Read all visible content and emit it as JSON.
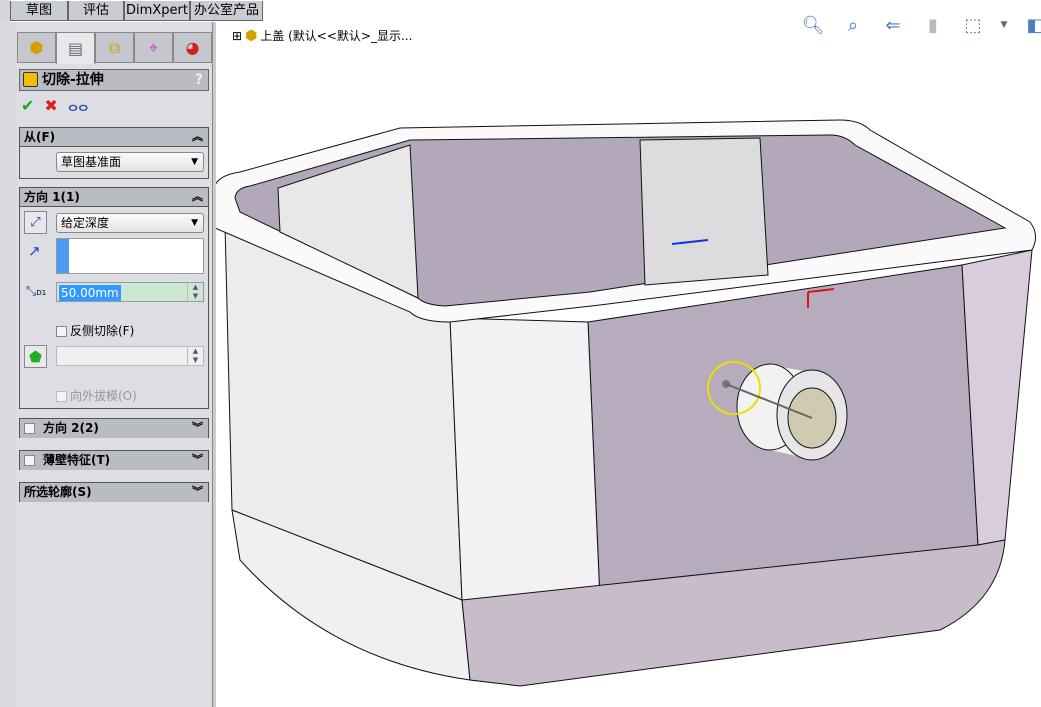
{
  "command_tabs": [
    "草图",
    "评估",
    "DimXpert",
    "办公室产品"
  ],
  "panel": {
    "tabs": [
      {
        "icon": "feature-manager-icon"
      },
      {
        "icon": "property-manager-icon"
      },
      {
        "icon": "configuration-manager-icon"
      },
      {
        "icon": "dimxpert-manager-icon"
      },
      {
        "icon": "display-manager-icon"
      }
    ],
    "title": "切除-拉伸",
    "help": "?",
    "actions": {
      "ok": "✔",
      "cancel": "✖",
      "preview": "ⴰⴰ"
    },
    "from": {
      "header": "从(F)",
      "value": "草图基准面"
    },
    "direction1": {
      "header": "方向 1(1)",
      "end_condition": "给定深度",
      "depth": "50.00mm",
      "depth_icon_label": "D1",
      "flip_side": "反侧切除(F)",
      "flip_checked": false,
      "draft_outward": "向外拔模(O)"
    },
    "direction2": {
      "header": "方向 2(2)",
      "checked": false
    },
    "thin_feature": {
      "header": "薄壁特征(T)",
      "checked": false
    },
    "selected_contours": {
      "header": "所选轮廓(S)"
    }
  },
  "tree": {
    "expander": "⊞",
    "label": "上盖  (默认<<默认>_显示..."
  },
  "view_tools": [
    "zoom-to-fit-icon",
    "zoom-to-area-icon",
    "previous-view-icon",
    "section-view-icon",
    "view-orientation-icon",
    "display-style-icon"
  ],
  "colors": {
    "panel": "#dcdee3",
    "header": "#b9bcc3",
    "model_purple": "#b5aabb",
    "depth_field": "#cde8d2"
  }
}
